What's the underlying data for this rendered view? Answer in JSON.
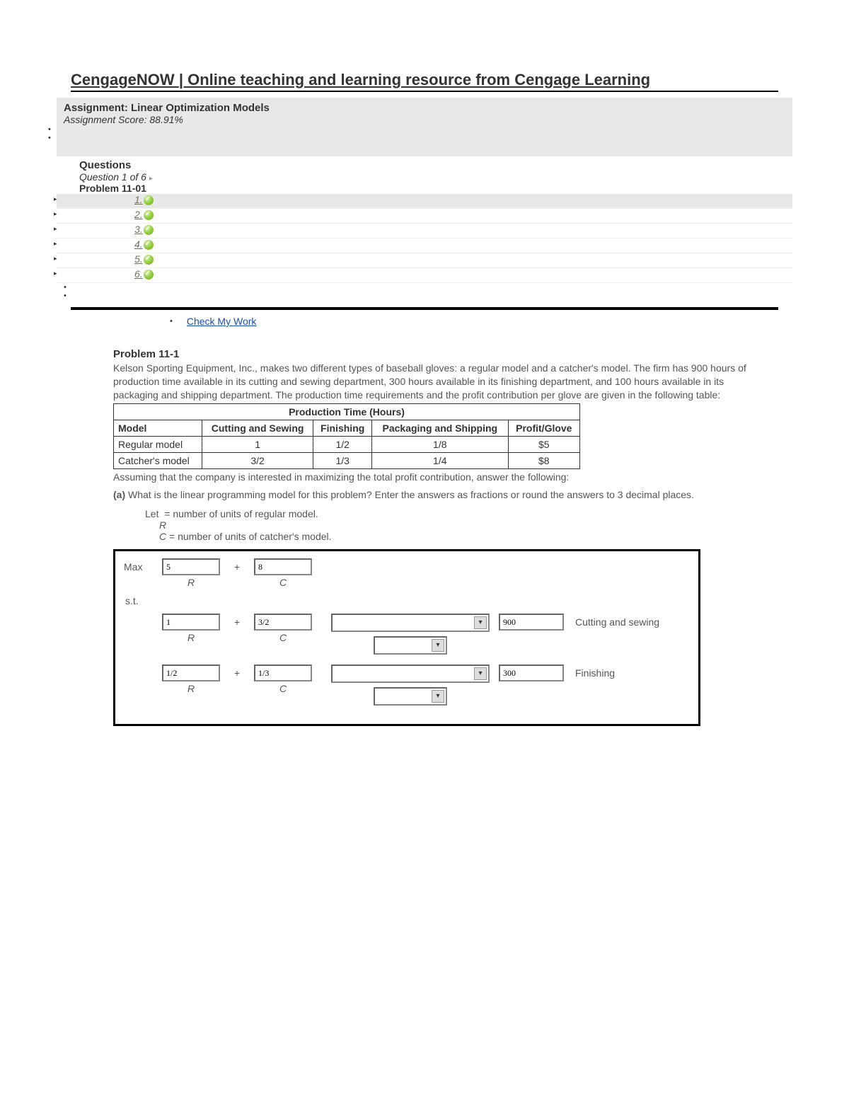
{
  "header": {
    "brand": "CengageNOW",
    "tagline": "Online teaching and learning resource from Cengage Learning"
  },
  "assignment": {
    "label": "Assignment:",
    "name": "Linear Optimization Models",
    "score_label": "Assignment Score:",
    "score": "88.91%"
  },
  "questions": {
    "heading": "Questions",
    "current": "Question 1 of 6",
    "problem_label": "Problem 11-01",
    "items": [
      {
        "num": "1.",
        "active": true
      },
      {
        "num": "2.",
        "active": false
      },
      {
        "num": "3.",
        "active": false
      },
      {
        "num": "4.",
        "active": false
      },
      {
        "num": "5.",
        "active": false
      },
      {
        "num": "6.",
        "active": false
      }
    ]
  },
  "check_my_work": "Check My Work",
  "problem": {
    "title": "Problem 11-1",
    "text": "Kelson Sporting Equipment, Inc., makes two different types of baseball gloves: a regular model and a catcher's model. The firm has 900 hours of production time available in its cutting and sewing department, 300 hours available in its finishing department, and 100 hours available in its packaging and shipping department. The production time requirements and the profit contribution per glove are given in the following table:",
    "table": {
      "super_header": "Production Time (Hours)",
      "headers": [
        "Model",
        "Cutting and Sewing",
        "Finishing",
        "Packaging and Shipping",
        "Profit/Glove"
      ],
      "rows": [
        [
          "Regular model",
          "1",
          "1/2",
          "1/8",
          "$5"
        ],
        [
          "Catcher's model",
          "3/2",
          "1/3",
          "1/4",
          "$8"
        ]
      ]
    },
    "followup": "Assuming that the company is interested in maximizing the total profit contribution, answer the following:",
    "part_a_label": "(a)",
    "part_a_text": "What is the linear programming model for this problem? Enter the answers as fractions or round the answers to 3 decimal places.",
    "let": {
      "line1_pre": "Let",
      "line1_post": "= number of units of regular model.",
      "var_r": "R",
      "var_c": "C",
      "line3": "= number of units of catcher's model."
    }
  },
  "answers": {
    "max_label": "Max",
    "plus": "+",
    "obj_r": "5",
    "obj_c": "8",
    "st_label": "s.t.",
    "c1_r": "1",
    "c1_c": "3/2",
    "c1_rhs": "900",
    "c1_name": "Cutting and sewing",
    "c2_r": "1/2",
    "c2_c": "1/3",
    "c2_rhs": "300",
    "c2_name": "Finishing",
    "var_r": "R",
    "var_c": "C"
  }
}
